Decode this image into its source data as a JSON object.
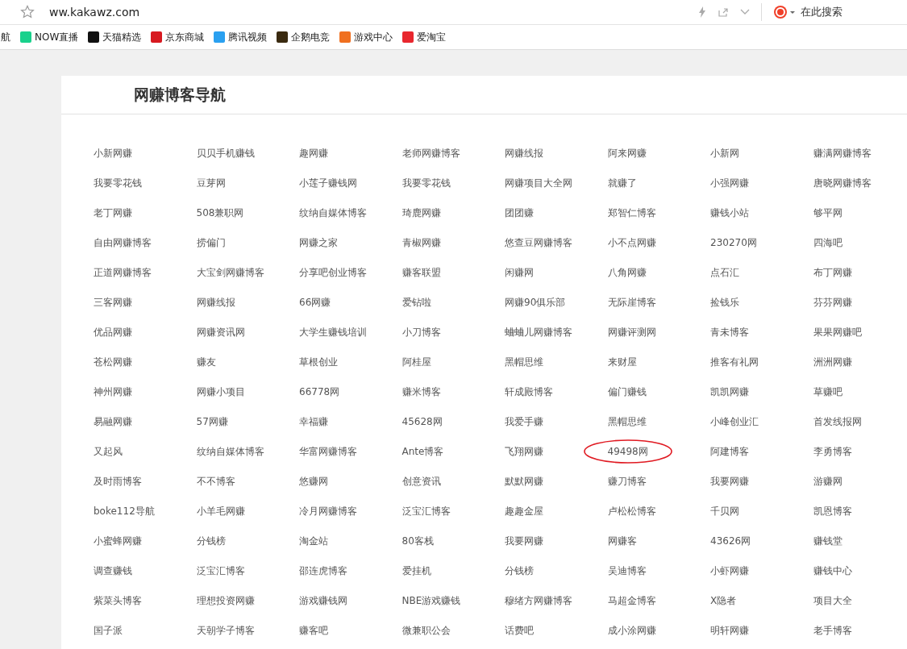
{
  "address_bar": {
    "url": "ww.kakawz.com",
    "search_placeholder": "在此搜索"
  },
  "bookmarks": [
    {
      "label": "航",
      "kind": "none"
    },
    {
      "label": "NOW直播",
      "kind": "now"
    },
    {
      "label": "天猫精选",
      "kind": "tmall"
    },
    {
      "label": "京东商城",
      "kind": "jd"
    },
    {
      "label": "腾讯视频",
      "kind": "video"
    },
    {
      "label": "企鹅电竞",
      "kind": "penguin"
    },
    {
      "label": "游戏中心",
      "kind": "game"
    },
    {
      "label": "爱淘宝",
      "kind": "taobao"
    }
  ],
  "page": {
    "title": "网赚博客导航",
    "rows": [
      [
        {
          "label": "小新网赚",
          "circled": false
        },
        {
          "label": "贝贝手机赚钱",
          "circled": false
        },
        {
          "label": "趣网赚",
          "circled": false
        },
        {
          "label": "老师网赚博客",
          "circled": false
        },
        {
          "label": "网赚线报",
          "circled": false
        },
        {
          "label": "阿来网赚",
          "circled": false
        },
        {
          "label": "小新网",
          "circled": false
        },
        {
          "label": "赚满网赚博客",
          "circled": false
        }
      ],
      [
        {
          "label": "我要零花钱",
          "circled": false
        },
        {
          "label": "豆芽网",
          "circled": false
        },
        {
          "label": "小莲子赚钱网",
          "circled": false
        },
        {
          "label": "我要零花钱",
          "circled": false
        },
        {
          "label": "网赚项目大全网",
          "circled": false
        },
        {
          "label": "就赚了",
          "circled": false
        },
        {
          "label": "小强网赚",
          "circled": false
        },
        {
          "label": "唐晓网赚博客",
          "circled": false
        }
      ],
      [
        {
          "label": "老丁网赚",
          "circled": false
        },
        {
          "label": "508兼职网",
          "circled": false
        },
        {
          "label": "纹纳自媒体博客",
          "circled": false
        },
        {
          "label": "琦鹿网赚",
          "circled": false
        },
        {
          "label": "团团赚",
          "circled": false
        },
        {
          "label": "郑智仁博客",
          "circled": false
        },
        {
          "label": "赚钱小站",
          "circled": false
        },
        {
          "label": "够平网",
          "circled": false
        }
      ],
      [
        {
          "label": "自由网赚博客",
          "circled": false
        },
        {
          "label": "捞偏门",
          "circled": false
        },
        {
          "label": "网赚之家",
          "circled": false
        },
        {
          "label": "青椒网赚",
          "circled": false
        },
        {
          "label": "悠查豆网赚博客",
          "circled": false
        },
        {
          "label": "小不点网赚",
          "circled": false
        },
        {
          "label": "230270网",
          "circled": false
        },
        {
          "label": "四海吧",
          "circled": false
        }
      ],
      [
        {
          "label": "正道网赚博客",
          "circled": false
        },
        {
          "label": "大宝剑网赚博客",
          "circled": false
        },
        {
          "label": "分享吧创业博客",
          "circled": false
        },
        {
          "label": "赚客联盟",
          "circled": false
        },
        {
          "label": "闲赚网",
          "circled": false
        },
        {
          "label": "八角网赚",
          "circled": false
        },
        {
          "label": "点石汇",
          "circled": false
        },
        {
          "label": "布丁网赚",
          "circled": false
        }
      ],
      [
        {
          "label": "三客网赚",
          "circled": false
        },
        {
          "label": "网赚线报",
          "circled": false
        },
        {
          "label": "66网赚",
          "circled": false
        },
        {
          "label": "爱钻啦",
          "circled": false
        },
        {
          "label": "网赚90俱乐部",
          "circled": false
        },
        {
          "label": "无际崖博客",
          "circled": false
        },
        {
          "label": "捡钱乐",
          "circled": false
        },
        {
          "label": "芬芬网赚",
          "circled": false
        }
      ],
      [
        {
          "label": "优品网赚",
          "circled": false
        },
        {
          "label": "网赚资讯网",
          "circled": false
        },
        {
          "label": "大学生赚钱培训",
          "circled": false
        },
        {
          "label": "小刀博客",
          "circled": false
        },
        {
          "label": "蛐蛐儿网赚博客",
          "circled": false
        },
        {
          "label": "网赚评测网",
          "circled": false
        },
        {
          "label": "青未博客",
          "circled": false
        },
        {
          "label": "果果网赚吧",
          "circled": false
        }
      ],
      [
        {
          "label": "苍松网赚",
          "circled": false
        },
        {
          "label": "赚友",
          "circled": false
        },
        {
          "label": "草根创业",
          "circled": false
        },
        {
          "label": "阿桂屋",
          "circled": false
        },
        {
          "label": "黑帽思维",
          "circled": false
        },
        {
          "label": "来财屋",
          "circled": false
        },
        {
          "label": "推客有礼网",
          "circled": false
        },
        {
          "label": "洲洲网赚",
          "circled": false
        }
      ],
      [
        {
          "label": "神州网赚",
          "circled": false
        },
        {
          "label": "网赚小项目",
          "circled": false
        },
        {
          "label": "66778网",
          "circled": false
        },
        {
          "label": "赚米博客",
          "circled": false
        },
        {
          "label": "轩成殿博客",
          "circled": false
        },
        {
          "label": "偏门赚钱",
          "circled": false
        },
        {
          "label": "凯凯网赚",
          "circled": false
        },
        {
          "label": "草赚吧",
          "circled": false
        }
      ],
      [
        {
          "label": "易融网赚",
          "circled": false
        },
        {
          "label": "57网赚",
          "circled": false
        },
        {
          "label": "幸福赚",
          "circled": false
        },
        {
          "label": "45628网",
          "circled": false
        },
        {
          "label": "我爱手赚",
          "circled": false
        },
        {
          "label": "黑帽思维",
          "circled": false
        },
        {
          "label": "小峰创业汇",
          "circled": false
        },
        {
          "label": "首发线报网",
          "circled": false
        }
      ],
      [
        {
          "label": "又起风",
          "circled": false
        },
        {
          "label": "纹纳自媒体博客",
          "circled": false
        },
        {
          "label": "华富网赚博客",
          "circled": false
        },
        {
          "label": "Ante博客",
          "circled": false
        },
        {
          "label": "飞翔网赚",
          "circled": false
        },
        {
          "label": "49498网",
          "circled": true
        },
        {
          "label": "阿建博客",
          "circled": false
        },
        {
          "label": "李勇博客",
          "circled": false
        }
      ],
      [
        {
          "label": "及时雨博客",
          "circled": false
        },
        {
          "label": "不不博客",
          "circled": false
        },
        {
          "label": "悠赚网",
          "circled": false
        },
        {
          "label": "创意资讯",
          "circled": false
        },
        {
          "label": "默默网赚",
          "circled": false
        },
        {
          "label": "赚刀博客",
          "circled": false
        },
        {
          "label": "我要网赚",
          "circled": false
        },
        {
          "label": "游赚网",
          "circled": false
        }
      ],
      [
        {
          "label": "boke112导航",
          "circled": false
        },
        {
          "label": "小羊毛网赚",
          "circled": false
        },
        {
          "label": "冷月网赚博客",
          "circled": false
        },
        {
          "label": "泛宝汇博客",
          "circled": false
        },
        {
          "label": "趣趣金屋",
          "circled": false
        },
        {
          "label": "卢松松博客",
          "circled": false
        },
        {
          "label": "千贝网",
          "circled": false
        },
        {
          "label": "凯恩博客",
          "circled": false
        }
      ],
      [
        {
          "label": "小蜜蜂网赚",
          "circled": false
        },
        {
          "label": "分钱榜",
          "circled": false
        },
        {
          "label": "淘金站",
          "circled": false
        },
        {
          "label": "80客栈",
          "circled": false
        },
        {
          "label": "我要网赚",
          "circled": false
        },
        {
          "label": "网赚客",
          "circled": false
        },
        {
          "label": "43626网",
          "circled": false
        },
        {
          "label": "赚钱堂",
          "circled": false
        }
      ],
      [
        {
          "label": "调查赚钱",
          "circled": false
        },
        {
          "label": "泛宝汇博客",
          "circled": false
        },
        {
          "label": "邵连虎博客",
          "circled": false
        },
        {
          "label": "爱挂机",
          "circled": false
        },
        {
          "label": "分钱榜",
          "circled": false
        },
        {
          "label": "吴迪博客",
          "circled": false
        },
        {
          "label": "小虾网赚",
          "circled": false
        },
        {
          "label": "赚钱中心",
          "circled": false
        }
      ],
      [
        {
          "label": "紫菜头博客",
          "circled": false
        },
        {
          "label": "理想投资网赚",
          "circled": false
        },
        {
          "label": "游戏赚钱网",
          "circled": false
        },
        {
          "label": "NBE游戏赚钱",
          "circled": false
        },
        {
          "label": "穆绪方网赚博客",
          "circled": false
        },
        {
          "label": "马超金博客",
          "circled": false
        },
        {
          "label": "X隐者",
          "circled": false
        },
        {
          "label": "项目大全",
          "circled": false
        }
      ],
      [
        {
          "label": "国子派",
          "circled": false
        },
        {
          "label": "天朝学子博客",
          "circled": false
        },
        {
          "label": "赚客吧",
          "circled": false
        },
        {
          "label": "微兼职公会",
          "circled": false
        },
        {
          "label": "话费吧",
          "circled": false
        },
        {
          "label": "成小涂网赚",
          "circled": false
        },
        {
          "label": "明轩网赚",
          "circled": false
        },
        {
          "label": "老手博客",
          "circled": false
        }
      ]
    ]
  }
}
